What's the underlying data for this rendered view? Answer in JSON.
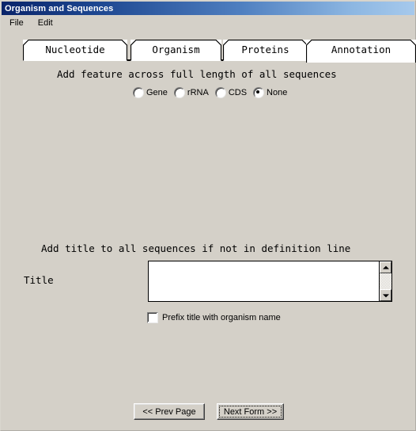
{
  "window": {
    "title": "Organism and Sequences"
  },
  "menubar": {
    "items": [
      {
        "label": "File"
      },
      {
        "label": "Edit"
      }
    ]
  },
  "tabs": [
    {
      "label": "Nucleotide",
      "selected": false
    },
    {
      "label": "Organism",
      "selected": false
    },
    {
      "label": "Proteins",
      "selected": false
    },
    {
      "label": "Annotation",
      "selected": true
    }
  ],
  "main": {
    "feature_section": {
      "heading": "Add feature across full length of all sequences",
      "radios": [
        {
          "label": "Gene",
          "checked": false
        },
        {
          "label": "rRNA",
          "checked": false
        },
        {
          "label": "CDS",
          "checked": false
        },
        {
          "label": "None",
          "checked": true
        }
      ]
    },
    "title_section": {
      "heading": "Add title to all sequences if not in definition line",
      "field_label": "Title",
      "field_value": "",
      "field_placeholder": "",
      "scrollbar": {
        "up_icon": "triangle-up-icon",
        "down_icon": "triangle-down-icon"
      },
      "checkbox": {
        "label": "Prefix title with organism name",
        "checked": false
      }
    },
    "footer": {
      "prev_label": "<< Prev Page",
      "next_label": "Next Form >>"
    }
  },
  "colors": {
    "window_face": "#d4d0c8",
    "titlebar_start": "#0a246a",
    "titlebar_end": "#a6c9ec",
    "field_background": "#ffffff",
    "text": "#000000"
  }
}
